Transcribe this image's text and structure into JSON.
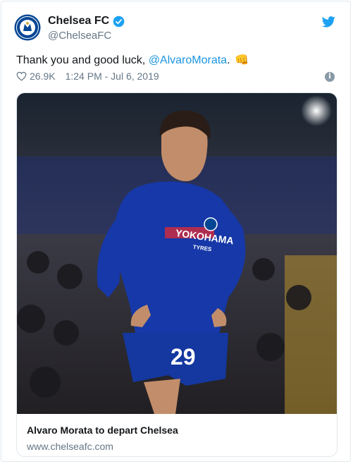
{
  "tweet": {
    "display_name": "Chelsea FC",
    "handle": "@ChelseaFC",
    "text_before": "Thank you and good luck, ",
    "mention": "@AlvaroMorata",
    "text_after": ".",
    "emoji": "👊",
    "likes": "26.9K",
    "timestamp": "1:24 PM - Jul 6, 2019",
    "info_glyph": "i"
  },
  "card": {
    "title": "Alvaro Morata to depart Chelsea",
    "domain": "www.chelseafc.com"
  },
  "icons": {
    "verified": "verified-badge-icon",
    "platform": "twitter-bird-icon",
    "like": "heart-icon",
    "info": "info-icon"
  },
  "colors": {
    "accent": "#1da1f2",
    "mention": "#1b95e0",
    "muted": "#657786",
    "border": "#e1e8ed",
    "club_blue": "#034694"
  },
  "image": {
    "player_number": "29",
    "sponsor": "YOKOHAMA",
    "sponsor_sub": "TYRES"
  }
}
